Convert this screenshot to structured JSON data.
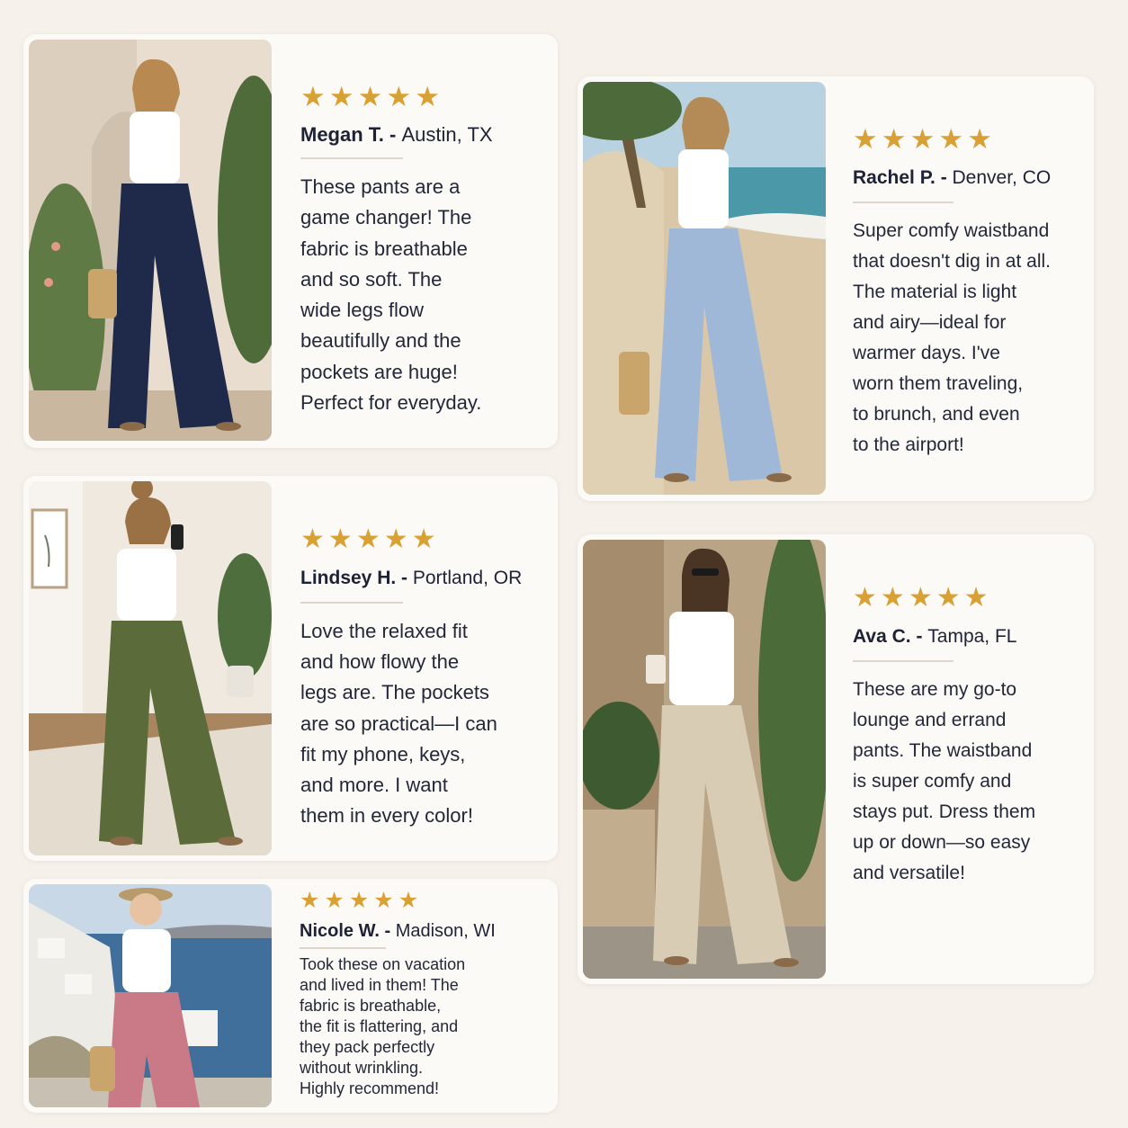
{
  "reviews": [
    {
      "rating": 5,
      "name": "Megan T.",
      "location": "Austin, TX",
      "review_lines": [
        "These pants are a",
        "game changer! The",
        "fabric is breathable",
        "and so soft. The",
        "wide legs flow",
        "beautifully and the",
        "pockets are huge!",
        "Perfect for everyday."
      ],
      "pants_color": "#1f2a4a"
    },
    {
      "rating": 5,
      "name": "Rachel P.",
      "location": "Denver, CO",
      "review_lines": [
        "Super comfy waistband",
        "that doesn't dig in at all.",
        "The material is light",
        "and airy—ideal for",
        "warmer days. I've",
        "worn them traveling,",
        "to brunch, and even",
        "to the airport!"
      ],
      "pants_color": "#9fb8d8"
    },
    {
      "rating": 5,
      "name": "Lindsey H.",
      "location": "Portland, OR",
      "review_lines": [
        "Love the relaxed fit",
        "and how flowy the",
        "legs are. The pockets",
        "are so practical—I can",
        "fit my phone, keys,",
        "and more. I want",
        "them in every color!"
      ],
      "pants_color": "#5b6b3a"
    },
    {
      "rating": 5,
      "name": "Ava C.",
      "location": "Tampa, FL",
      "review_lines": [
        "These are my go-to",
        "lounge and errand",
        "pants. The waistband",
        "is super comfy and",
        "stays put. Dress them",
        "up or down—so easy",
        "and versatile!"
      ],
      "pants_color": "#d9ccb4"
    },
    {
      "rating": 5,
      "name": "Nicole W.",
      "location": "Madison, WI",
      "review_lines": [
        "Took these on vacation",
        "and lived in them! The",
        "fabric is breathable,",
        "the fit is flattering, and",
        "they pack perfectly",
        "without wrinkling.",
        "Highly recommend!"
      ],
      "pants_color": "#c97a86"
    }
  ],
  "colors": {
    "background": "#f6f1eb",
    "card": "#fcfaf7",
    "star": "#d9a033",
    "text": "#1d2235"
  },
  "icons": {
    "star": "★"
  }
}
